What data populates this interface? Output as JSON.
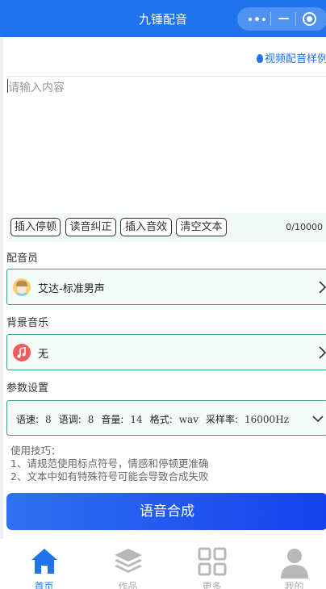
{
  "header": {
    "title": "九锤配音"
  },
  "sample_link": {
    "label": "视频配音样例"
  },
  "editor": {
    "placeholder": "请输入内容",
    "value": ""
  },
  "toolbar": {
    "buttons": [
      "插入停顿",
      "读音纠正",
      "插入音效",
      "清空文本"
    ],
    "counter": "0/10000"
  },
  "voice": {
    "section_label": "配音员",
    "selected": "艾达-标准男声"
  },
  "music": {
    "section_label": "背景音乐",
    "selected": "无"
  },
  "params": {
    "section_label": "参数设置",
    "items": [
      {
        "label": "语速:",
        "value": "8"
      },
      {
        "label": "语调:",
        "value": "8"
      },
      {
        "label": "音量:",
        "value": "14"
      },
      {
        "label": "格式:",
        "value": "wav"
      },
      {
        "label": "采样率:",
        "value": "16000Hz"
      }
    ]
  },
  "tips": {
    "title": "使用技巧：",
    "lines": [
      "1、请规范使用标点符号，情感和停顿更准确",
      "2、文本中如有特殊符号可能会导致合成失败"
    ]
  },
  "synthesize_button": {
    "label": "语音合成"
  },
  "bottom_nav": {
    "items": [
      {
        "label": "首页",
        "icon": "home-icon",
        "active": true
      },
      {
        "label": "作品",
        "icon": "layers-icon",
        "active": false
      },
      {
        "label": "更多",
        "icon": "grid-icon",
        "active": false
      },
      {
        "label": "我的",
        "icon": "user-icon",
        "active": false
      }
    ]
  },
  "colors": {
    "primary": "#1f74ee",
    "accent_border": "#3aa07f",
    "panel_bg": "#f4fbf8",
    "inactive": "#aaaaaa"
  }
}
